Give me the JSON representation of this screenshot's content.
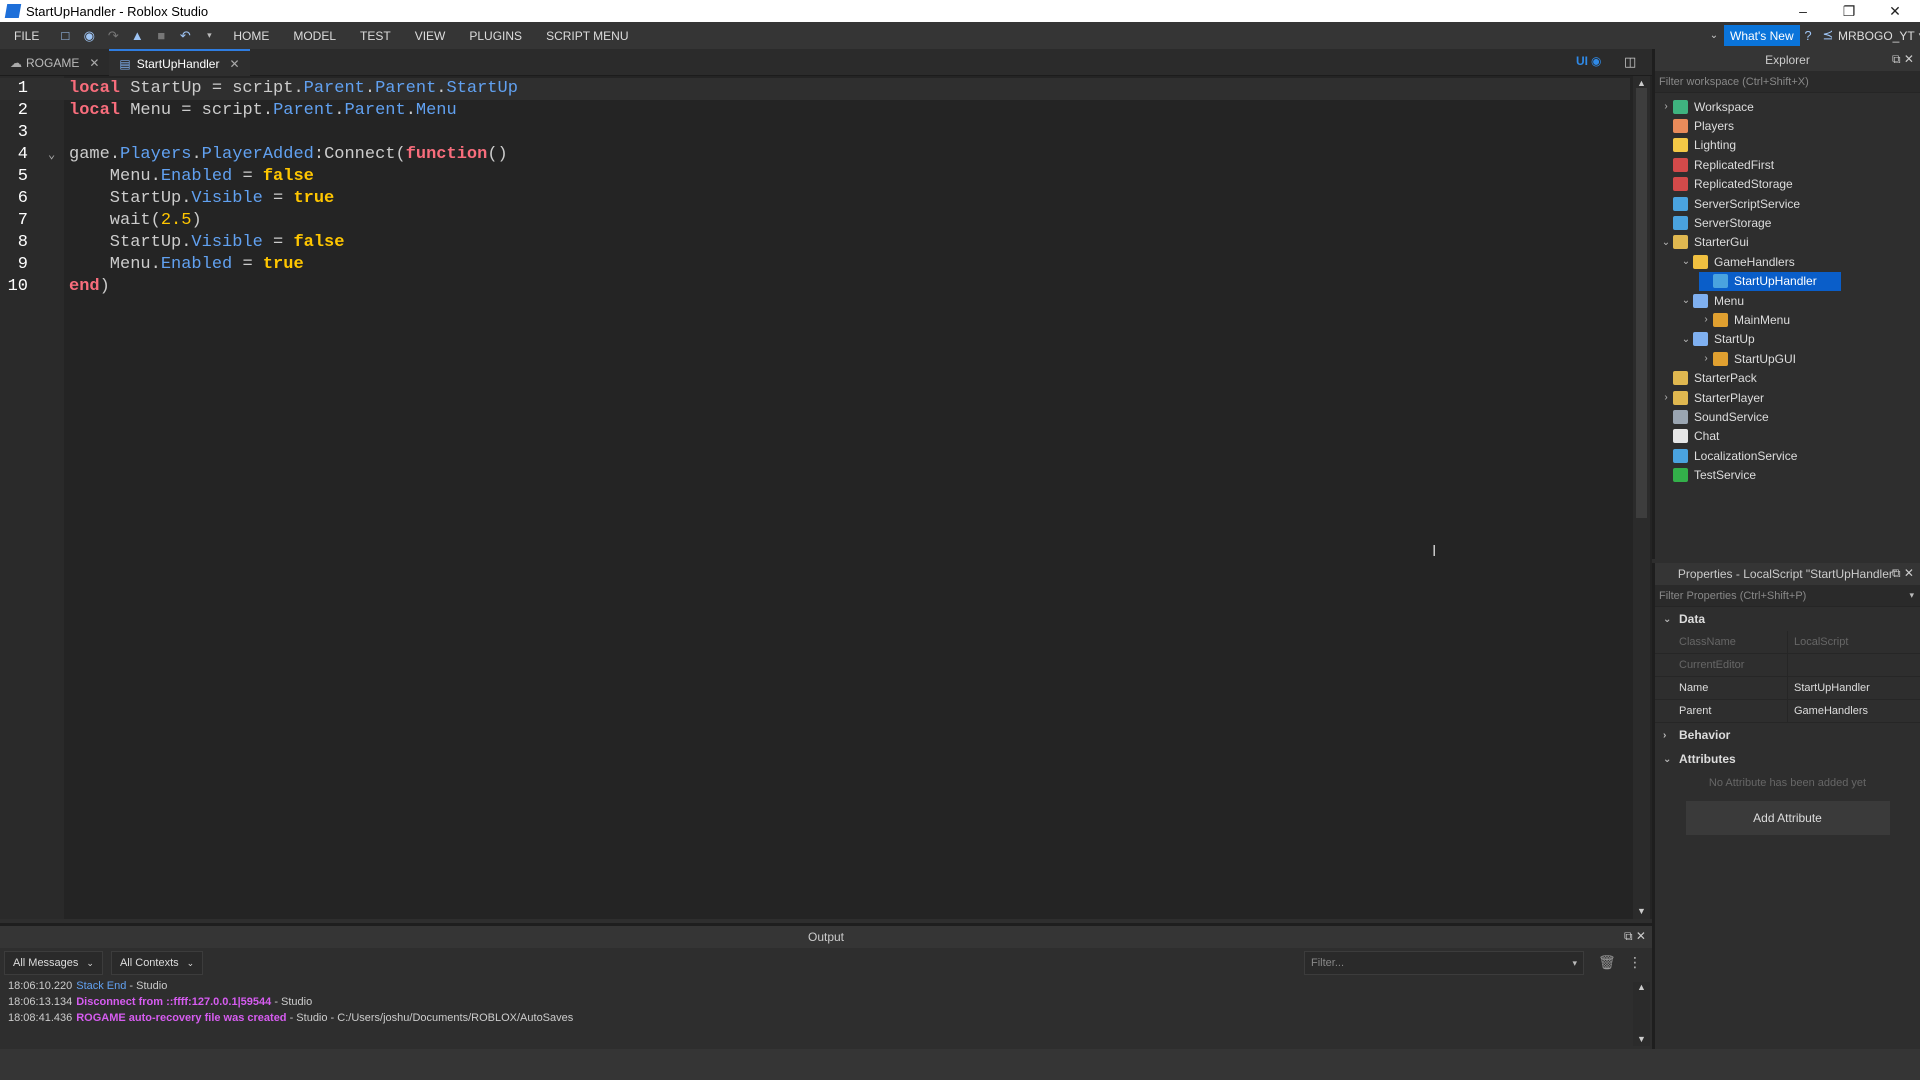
{
  "window": {
    "title": "StartUpHandler - Roblox Studio",
    "minimize": "–",
    "restore": "❐",
    "close": "✕"
  },
  "menu": {
    "items": [
      "FILE",
      "HOME",
      "MODEL",
      "TEST",
      "VIEW",
      "PLUGINS",
      "SCRIPT MENU"
    ],
    "whats_new": "What's New",
    "user": "MRBOGO_YT"
  },
  "tabs": [
    {
      "label": "ROGAME"
    },
    {
      "label": "StartUpHandler"
    }
  ],
  "editor_toggle": "UI",
  "code": {
    "line_numbers": [
      "1",
      "2",
      "3",
      "4",
      "5",
      "6",
      "7",
      "8",
      "9",
      "10"
    ],
    "lines": [
      [
        [
          "kw",
          "local"
        ],
        [
          "id",
          " StartUp = "
        ],
        [
          "id",
          "script"
        ],
        [
          "op",
          "."
        ],
        [
          "prop",
          "Parent"
        ],
        [
          "op",
          "."
        ],
        [
          "prop",
          "Parent"
        ],
        [
          "op",
          "."
        ],
        [
          "prop",
          "StartUp"
        ]
      ],
      [
        [
          "kw",
          "local"
        ],
        [
          "id",
          " Menu = "
        ],
        [
          "id",
          "script"
        ],
        [
          "op",
          "."
        ],
        [
          "prop",
          "Parent"
        ],
        [
          "op",
          "."
        ],
        [
          "prop",
          "Parent"
        ],
        [
          "op",
          "."
        ],
        [
          "prop",
          "Menu"
        ]
      ],
      [],
      [
        [
          "id",
          "game"
        ],
        [
          "op",
          "."
        ],
        [
          "prop",
          "Players"
        ],
        [
          "op",
          "."
        ],
        [
          "prop",
          "PlayerAdded"
        ],
        [
          "op",
          ":"
        ],
        [
          "id",
          "Connect"
        ],
        [
          "op",
          "("
        ],
        [
          "kw",
          "function"
        ],
        [
          "op",
          "()"
        ]
      ],
      [
        [
          "id",
          "    Menu"
        ],
        [
          "op",
          "."
        ],
        [
          "prop",
          "Enabled"
        ],
        [
          "op",
          " = "
        ],
        [
          "kwv",
          "false"
        ]
      ],
      [
        [
          "id",
          "    StartUp"
        ],
        [
          "op",
          "."
        ],
        [
          "prop",
          "Visible"
        ],
        [
          "op",
          " = "
        ],
        [
          "kwv",
          "true"
        ]
      ],
      [
        [
          "id",
          "    wait"
        ],
        [
          "op",
          "("
        ],
        [
          "num",
          "2.5"
        ],
        [
          "op",
          ")"
        ]
      ],
      [
        [
          "id",
          "    StartUp"
        ],
        [
          "op",
          "."
        ],
        [
          "prop",
          "Visible"
        ],
        [
          "op",
          " = "
        ],
        [
          "kwv",
          "false"
        ]
      ],
      [
        [
          "id",
          "    Menu"
        ],
        [
          "op",
          "."
        ],
        [
          "prop",
          "Enabled"
        ],
        [
          "op",
          " = "
        ],
        [
          "kwv",
          "true"
        ]
      ],
      [
        [
          "kw",
          "end"
        ],
        [
          "op",
          ")"
        ]
      ]
    ]
  },
  "explorer": {
    "title": "Explorer",
    "filter_placeholder": "Filter workspace (Ctrl+Shift+X)",
    "items": [
      {
        "label": "Workspace",
        "depth": 0,
        "chevron": "›",
        "icon_color": "#3fb37f"
      },
      {
        "label": "Players",
        "depth": 0,
        "chevron": "",
        "icon_color": "#e98b5a"
      },
      {
        "label": "Lighting",
        "depth": 0,
        "chevron": "",
        "icon_color": "#f3c846"
      },
      {
        "label": "ReplicatedFirst",
        "depth": 0,
        "chevron": "",
        "icon_color": "#d34a4a"
      },
      {
        "label": "ReplicatedStorage",
        "depth": 0,
        "chevron": "",
        "icon_color": "#d34a4a"
      },
      {
        "label": "ServerScriptService",
        "depth": 0,
        "chevron": "",
        "icon_color": "#4aa3df"
      },
      {
        "label": "ServerStorage",
        "depth": 0,
        "chevron": "",
        "icon_color": "#4aa3df"
      },
      {
        "label": "StarterGui",
        "depth": 0,
        "chevron": "⌄",
        "icon_color": "#e0b850"
      },
      {
        "label": "GameHandlers",
        "depth": 1,
        "chevron": "⌄",
        "icon_color": "#f0c040"
      },
      {
        "label": "StartUpHandler",
        "depth": 2,
        "chevron": "",
        "icon_color": "#4aa3df",
        "selected": true
      },
      {
        "label": "Menu",
        "depth": 1,
        "chevron": "⌄",
        "icon_color": "#7fb0f0"
      },
      {
        "label": "MainMenu",
        "depth": 2,
        "chevron": "›",
        "icon_color": "#e0a030"
      },
      {
        "label": "StartUp",
        "depth": 1,
        "chevron": "⌄",
        "icon_color": "#7fb0f0"
      },
      {
        "label": "StartUpGUI",
        "depth": 2,
        "chevron": "›",
        "icon_color": "#e0a030"
      },
      {
        "label": "StarterPack",
        "depth": 0,
        "chevron": "",
        "icon_color": "#e0b850"
      },
      {
        "label": "StarterPlayer",
        "depth": 0,
        "chevron": "›",
        "icon_color": "#e0b850"
      },
      {
        "label": "SoundService",
        "depth": 0,
        "chevron": "",
        "icon_color": "#9aa5b1"
      },
      {
        "label": "Chat",
        "depth": 0,
        "chevron": "",
        "icon_color": "#e6e6e6"
      },
      {
        "label": "LocalizationService",
        "depth": 0,
        "chevron": "",
        "icon_color": "#4aa3df"
      },
      {
        "label": "TestService",
        "depth": 0,
        "chevron": "",
        "icon_color": "#33b04a"
      }
    ]
  },
  "properties": {
    "title": "Properties - LocalScript \"StartUpHandler\"",
    "filter_placeholder": "Filter Properties (Ctrl+Shift+P)",
    "sections": {
      "data": "Data",
      "behavior": "Behavior",
      "attributes": "Attributes"
    },
    "rows": [
      {
        "key": "ClassName",
        "value": "LocalScript",
        "dim": true
      },
      {
        "key": "CurrentEditor",
        "value": "",
        "dim": true
      },
      {
        "key": "Name",
        "value": "StartUpHandler",
        "dim": false
      },
      {
        "key": "Parent",
        "value": "GameHandlers",
        "dim": false
      }
    ],
    "no_attribute": "No Attribute has been added yet",
    "add_attribute": "Add Attribute"
  },
  "output": {
    "title": "Output",
    "messages_filter": "All Messages",
    "contexts_filter": "All Contexts",
    "filter_placeholder": "Filter...",
    "logs": [
      {
        "time": "18:06:10.220",
        "msg": "Stack End",
        "msg_color": "#61a1f1",
        "bold": false,
        "src": " - Studio"
      },
      {
        "time": "18:06:13.134",
        "msg": "Disconnect from ::ffff:127.0.0.1|59544",
        "msg_color": "#d65cf0",
        "bold": true,
        "src": " - Studio"
      },
      {
        "time": "18:08:41.436",
        "msg": "ROGAME auto-recovery file was created",
        "msg_color": "#d65cf0",
        "bold": true,
        "src": " - Studio - C:/Users/joshu/Documents/ROBLOX/AutoSaves"
      }
    ]
  }
}
